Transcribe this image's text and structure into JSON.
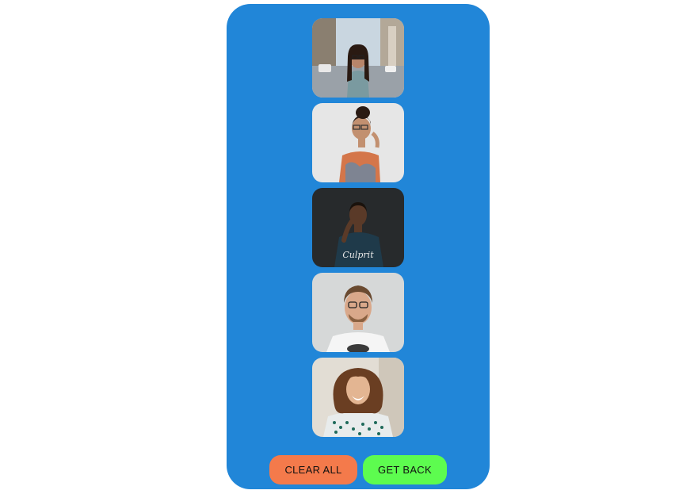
{
  "panel": {
    "background": "#2186d8"
  },
  "photos": [
    {
      "icon": "portrait-woman-glasses-street-photo"
    },
    {
      "icon": "portrait-woman-glasses-tattoo-photo"
    },
    {
      "icon": "portrait-man-dark-shirt-photo"
    },
    {
      "icon": "portrait-man-glasses-white-tee-photo"
    },
    {
      "icon": "portrait-woman-curly-hair-smiling-photo"
    }
  ],
  "actions": {
    "clear_label": "CLEAR ALL",
    "clear_color": "#f47a4b",
    "back_label": "GET BACK",
    "back_color": "#5dfc4f"
  }
}
